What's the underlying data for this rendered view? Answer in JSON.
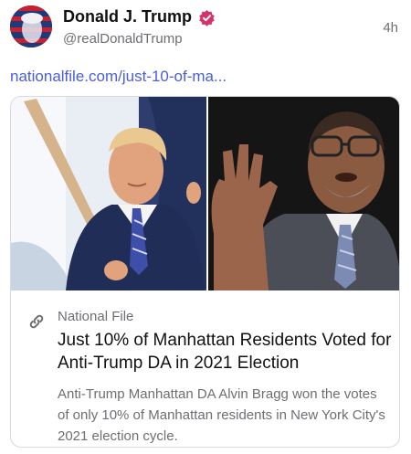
{
  "post": {
    "author_name": "Donald J. Trump",
    "handle": "@realDonaldTrump",
    "time": "4h",
    "link_text": "nationalfile.com/just-10-of-ma..."
  },
  "card": {
    "source": "National File",
    "title": "Just 10% of Manhattan Residents Voted for Anti-Trump DA in 2021 Election",
    "description": "Anti-Trump Manhattan DA Alvin Bragg won the votes of only 10% of Manhattan residents in New York City's 2021 election cycle."
  },
  "icons": {
    "verified": "verified-badge-icon",
    "link": "link-chain-icon"
  },
  "colors": {
    "link": "#4a5fd6",
    "verified": "#d6336c",
    "muted": "#6e6e73"
  }
}
